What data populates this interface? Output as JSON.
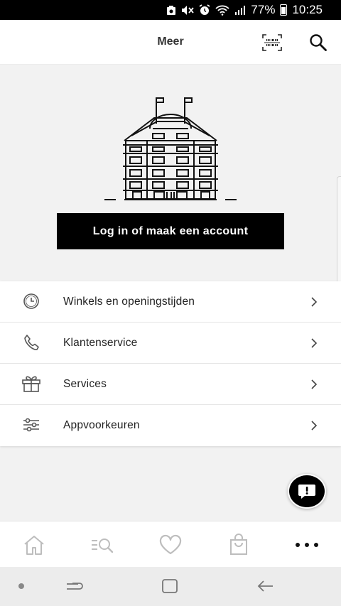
{
  "status_bar": {
    "battery_percent": "77%",
    "time": "10:25"
  },
  "header": {
    "title": "Meer",
    "scan_icon": "barcode-scan-icon",
    "search_icon": "search-icon"
  },
  "hero": {
    "illustration": "building-illustration",
    "login_button_label": "Log in of maak een account"
  },
  "menu": {
    "items": [
      {
        "label": "Winkels en openingstijden",
        "icon": "clock-icon"
      },
      {
        "label": "Klantenservice",
        "icon": "phone-icon"
      },
      {
        "label": "Services",
        "icon": "gift-icon"
      },
      {
        "label": "Appvoorkeuren",
        "icon": "sliders-icon"
      }
    ]
  },
  "tabbar": {
    "tabs": [
      {
        "icon": "home-icon"
      },
      {
        "icon": "search-list-icon"
      },
      {
        "icon": "heart-icon"
      },
      {
        "icon": "shopping-bag-icon"
      },
      {
        "icon": "more-icon",
        "active": true
      }
    ]
  },
  "colors": {
    "primary": "#000000",
    "background": "#f2f2f2",
    "inactive_icon": "#bdbdbd"
  }
}
